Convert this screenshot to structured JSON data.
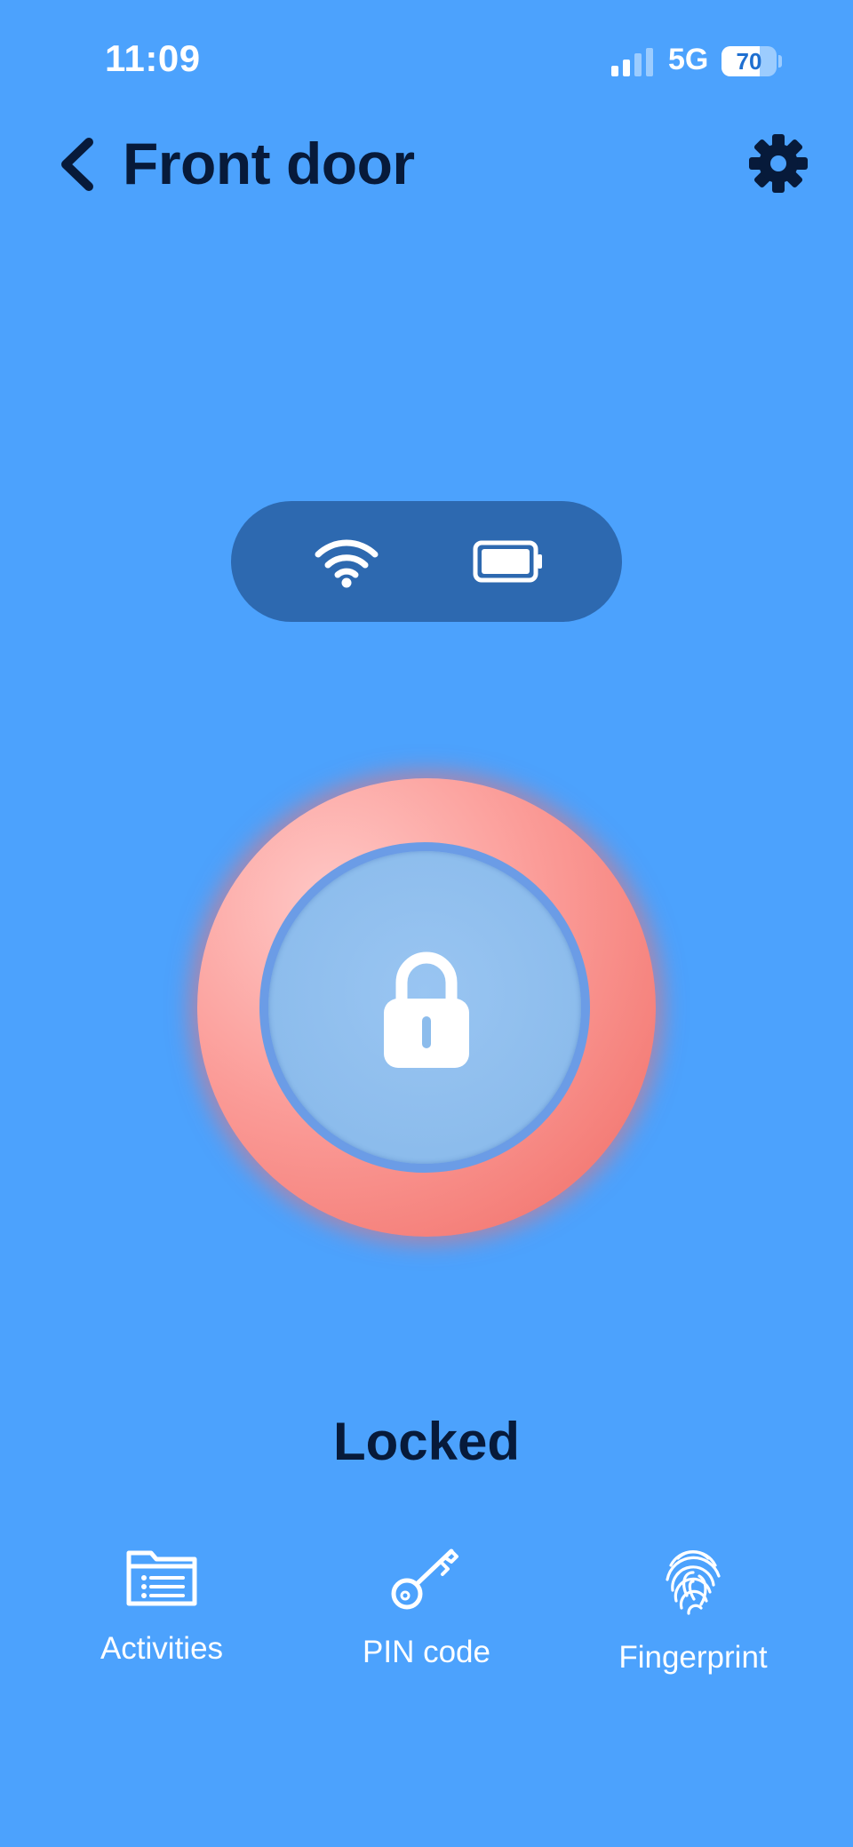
{
  "status_bar": {
    "time": "11:09",
    "network": "5G",
    "battery_percent": "70",
    "battery_level": 0.7
  },
  "header": {
    "title": "Front door",
    "back_icon": "chevron-left-icon",
    "settings_icon": "gear-icon"
  },
  "connectivity": {
    "wifi_icon": "wifi-icon",
    "battery_icon": "battery-full-icon"
  },
  "lock": {
    "icon": "padlock-icon",
    "state_label": "Locked",
    "ring_color": "#f57570",
    "inner_color": "#8cbcec"
  },
  "actions": [
    {
      "label": "Activities",
      "icon": "folder-list-icon"
    },
    {
      "label": "PIN code",
      "icon": "key-icon"
    },
    {
      "label": "Fingerprint",
      "icon": "fingerprint-icon"
    }
  ],
  "colors": {
    "background": "#4ca2fd",
    "pill": "#2d69b0",
    "title_text": "#071a3a"
  }
}
